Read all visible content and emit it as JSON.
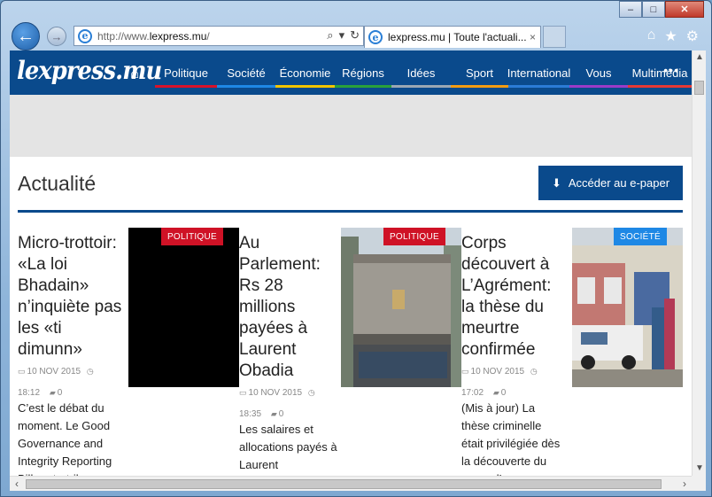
{
  "browser": {
    "url_prefix": "http://www.",
    "url_domain": "lexpress.mu",
    "url_suffix": "/",
    "tab_title": "lexpress.mu | Toute l'actuali...",
    "tab_close": "×",
    "back": "←",
    "forward": "→",
    "search_icon": "⌕",
    "dropdown_icon": "▾",
    "refresh_icon": "↻",
    "home_icon": "⌂",
    "favorites_icon": "★",
    "settings_icon": "⚙",
    "min": "–",
    "max": "□",
    "close": "✕"
  },
  "site": {
    "logo": "lexpress.mu",
    "home_icon": "⌂",
    "nav": [
      {
        "label": "Politique",
        "color": "#d8122a"
      },
      {
        "label": "Société",
        "color": "#1e88e5"
      },
      {
        "label": "Économie",
        "color": "#f2c500"
      },
      {
        "label": "Régions",
        "color": "#2aa13a"
      },
      {
        "label": "Idées",
        "color": "#9aa7b3"
      },
      {
        "label": "Sport",
        "color": "#f39c12"
      },
      {
        "label": "International",
        "color": "#2b7bd6"
      },
      {
        "label": "Vous",
        "color": "#9b3bc8"
      },
      {
        "label": "Multimédia",
        "color": "#e53935"
      }
    ],
    "more": "•••"
  },
  "section": {
    "title": "Actualité",
    "epaper_label": "Accéder au e-paper",
    "download_icon": "⬇"
  },
  "articles": [
    {
      "title": "Micro-trottoir: «La loi Bhadain» n’inquiète pas les «ti dimunn»",
      "date": "10 NOV 2015",
      "time": "18:12",
      "comments": "0",
      "excerpt": "C’est le débat du moment. Le Good Governance and Integrity Reporting Bill porte-t-il"
    },
    {
      "badge": "POLITIQUE",
      "title": "Au Parlement: Rs 28 millions payées à Laurent Obadia",
      "date": "10 NOV 2015",
      "time": "18:35",
      "comments": "0",
      "excerpt": "Les salaires et allocations payés à Laurent"
    },
    {
      "badge": "POLITIQUE",
      "title": "Corps découvert à L’Agrément: la thèse du meurtre confirmée",
      "date": "10 NOV 2015",
      "time": "17:02",
      "comments": "0",
      "excerpt": "(Mis à jour) La thèse criminelle était privilégiée dès la découverte du corps d’un"
    },
    {
      "badge": "SOCIÉTÉ"
    }
  ]
}
